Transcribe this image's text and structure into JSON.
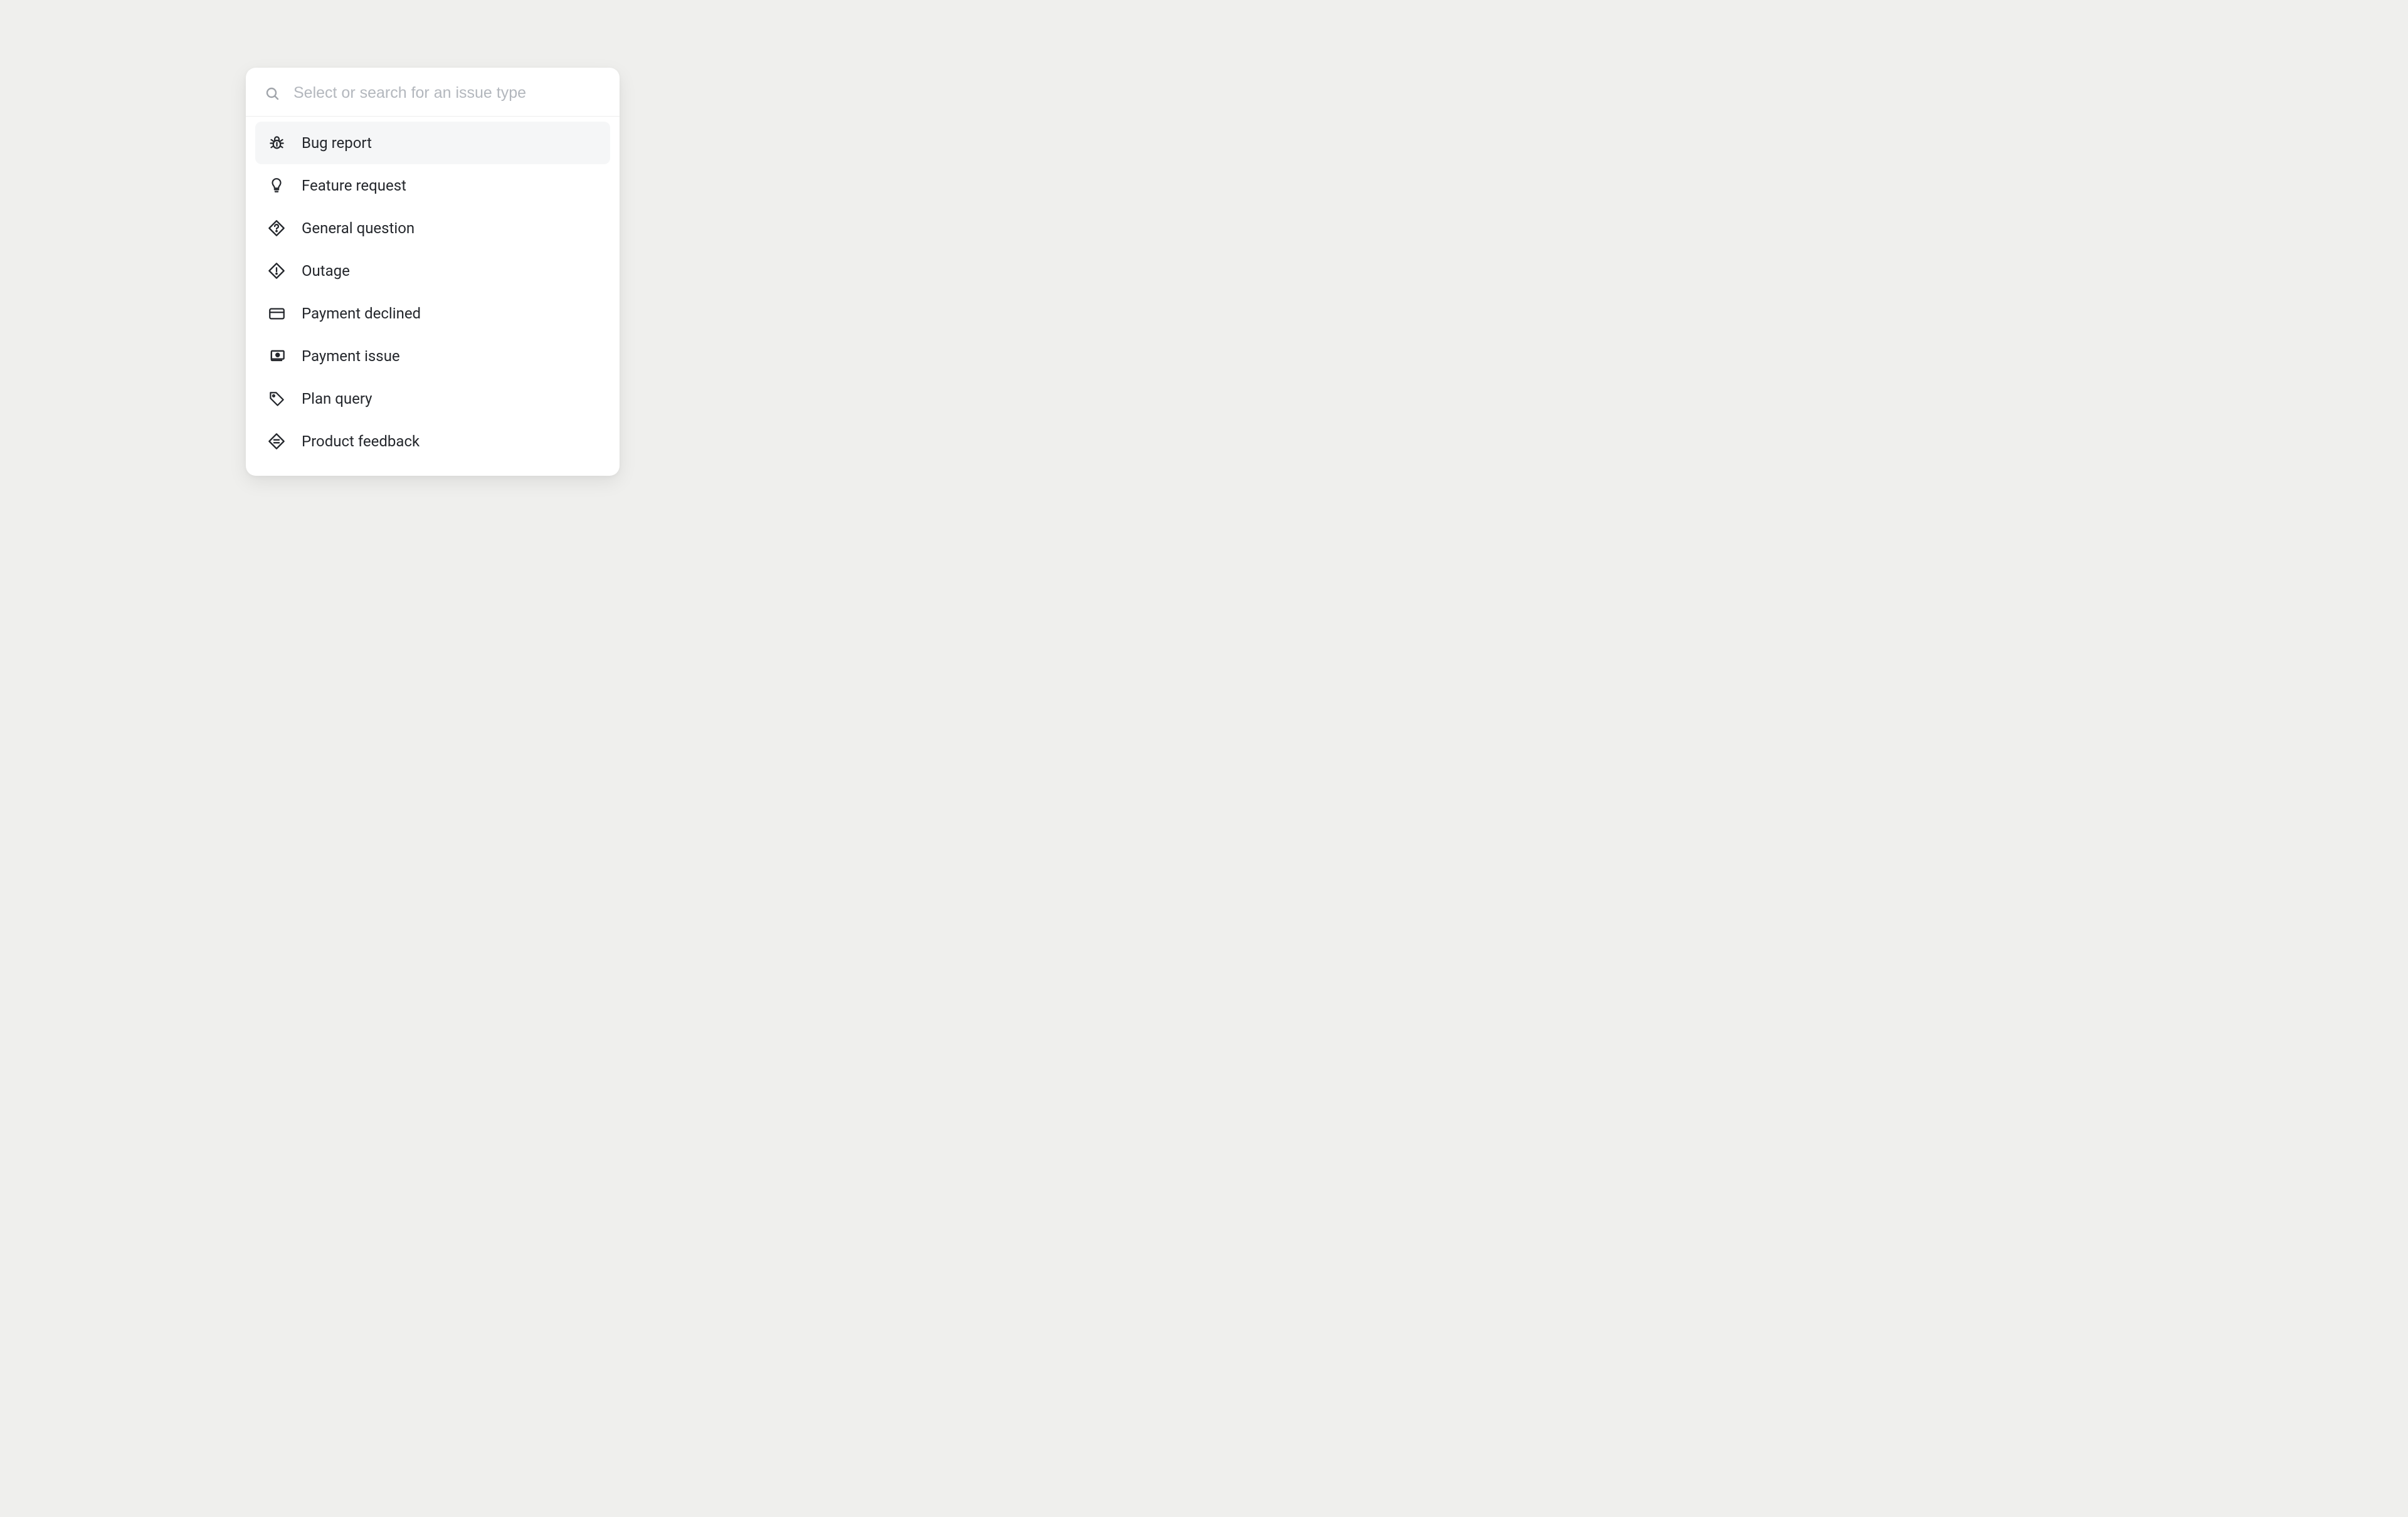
{
  "search": {
    "placeholder": "Select or search for an issue type"
  },
  "options": [
    {
      "icon": "bug-icon",
      "label": "Bug report",
      "highlighted": true
    },
    {
      "icon": "lightbulb-icon",
      "label": "Feature request",
      "highlighted": false
    },
    {
      "icon": "question-diamond-icon",
      "label": "General question",
      "highlighted": false
    },
    {
      "icon": "alert-diamond-icon",
      "label": "Outage",
      "highlighted": false
    },
    {
      "icon": "credit-card-icon",
      "label": "Payment declined",
      "highlighted": false
    },
    {
      "icon": "cash-icon",
      "label": "Payment issue",
      "highlighted": false
    },
    {
      "icon": "tag-icon",
      "label": "Plan query",
      "highlighted": false
    },
    {
      "icon": "feedback-diamond-icon",
      "label": "Product feedback",
      "highlighted": false
    }
  ]
}
